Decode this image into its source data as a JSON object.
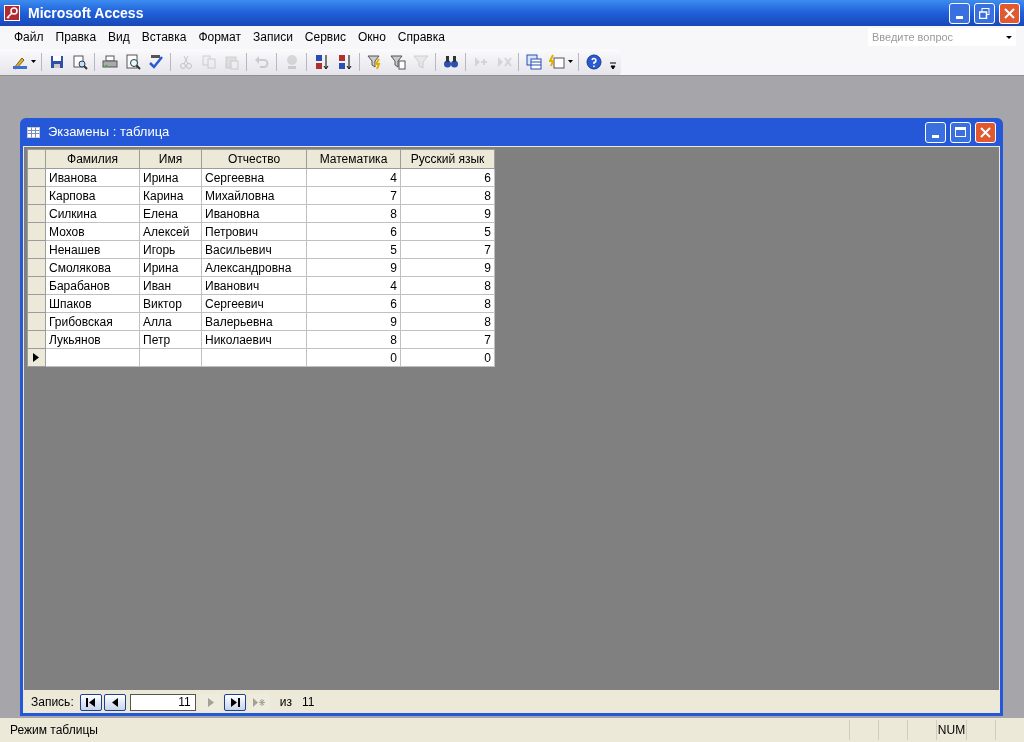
{
  "window": {
    "title": "Microsoft Access"
  },
  "menu": [
    "Файл",
    "Правка",
    "Вид",
    "Вставка",
    "Формат",
    "Записи",
    "Сервис",
    "Окно",
    "Справка"
  ],
  "help_search": {
    "placeholder": "Введите вопрос"
  },
  "toolbar": [
    {
      "kind": "design",
      "disabled": false
    },
    {
      "kind": "sep"
    },
    {
      "kind": "save",
      "disabled": false
    },
    {
      "kind": "search-file",
      "disabled": false
    },
    {
      "kind": "sep"
    },
    {
      "kind": "print",
      "disabled": false
    },
    {
      "kind": "preview",
      "disabled": false
    },
    {
      "kind": "spell",
      "disabled": false
    },
    {
      "kind": "sep"
    },
    {
      "kind": "cut",
      "disabled": true
    },
    {
      "kind": "copy",
      "disabled": true
    },
    {
      "kind": "paste",
      "disabled": true
    },
    {
      "kind": "sep"
    },
    {
      "kind": "undo",
      "disabled": true
    },
    {
      "kind": "sep"
    },
    {
      "kind": "link",
      "disabled": true
    },
    {
      "kind": "sep"
    },
    {
      "kind": "sort-asc",
      "disabled": false
    },
    {
      "kind": "sort-desc",
      "disabled": false
    },
    {
      "kind": "sep"
    },
    {
      "kind": "filter-selection",
      "disabled": false
    },
    {
      "kind": "filter-form",
      "disabled": false
    },
    {
      "kind": "filter",
      "disabled": true
    },
    {
      "kind": "sep"
    },
    {
      "kind": "find",
      "disabled": false
    },
    {
      "kind": "sep"
    },
    {
      "kind": "new-record",
      "disabled": true
    },
    {
      "kind": "delete-record",
      "disabled": true
    },
    {
      "kind": "sep"
    },
    {
      "kind": "database",
      "disabled": false
    },
    {
      "kind": "new-object",
      "disabled": false
    },
    {
      "kind": "sep"
    },
    {
      "kind": "help",
      "disabled": false
    }
  ],
  "child_window": {
    "title": "Экзамены : таблица"
  },
  "table": {
    "columns": [
      "Фамилия",
      "Имя",
      "Отчество",
      "Математика",
      "Русский язык"
    ],
    "rows": [
      {
        "cells": [
          "Иванова",
          "Ирина",
          "Сергеевна",
          "4",
          "6"
        ],
        "current": false
      },
      {
        "cells": [
          "Карпова",
          "Карина",
          "Михайловна",
          "7",
          "8"
        ],
        "current": false
      },
      {
        "cells": [
          "Силкина",
          "Елена",
          "Ивановна",
          "8",
          "9"
        ],
        "current": false
      },
      {
        "cells": [
          "Мохов",
          "Алексей",
          "Петрович",
          "6",
          "5"
        ],
        "current": false
      },
      {
        "cells": [
          "Ненашев",
          "Игорь",
          "Васильевич",
          "5",
          "7"
        ],
        "current": false
      },
      {
        "cells": [
          "Смолякова",
          "Ирина",
          "Александровна",
          "9",
          "9"
        ],
        "current": false
      },
      {
        "cells": [
          "Барабанов",
          "Иван",
          "Иванович",
          "4",
          "8"
        ],
        "current": false
      },
      {
        "cells": [
          "Шпаков",
          "Виктор",
          "Сергеевич",
          "6",
          "8"
        ],
        "current": false
      },
      {
        "cells": [
          "Грибовская",
          "Алла",
          "Валерьевна",
          "9",
          "8"
        ],
        "current": false
      },
      {
        "cells": [
          "Лукьянов",
          "Петр",
          "Николаевич",
          "8",
          "7"
        ],
        "current": false
      },
      {
        "cells": [
          null,
          null,
          null,
          "0",
          "0"
        ],
        "current": true
      }
    ]
  },
  "record_nav": {
    "label": "Запись:",
    "current": "11",
    "of_label": "из",
    "total": "11",
    "buttons": [
      {
        "kind": "first",
        "disabled": false
      },
      {
        "kind": "prev",
        "disabled": false
      },
      {
        "kind": "next",
        "disabled": true
      },
      {
        "kind": "last",
        "disabled": false
      },
      {
        "kind": "new",
        "disabled": true
      }
    ]
  },
  "status_bar": {
    "mode": "Режим таблицы",
    "indicators": [
      "NUM"
    ]
  }
}
